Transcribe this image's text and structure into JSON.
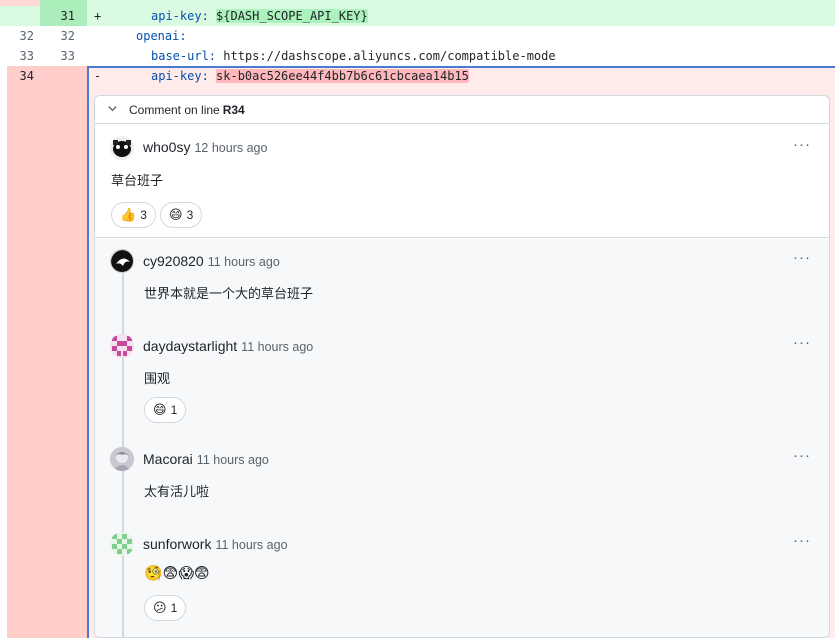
{
  "diff": {
    "added_row": {
      "old": "",
      "new": "31",
      "sign": "+",
      "key": "api-key:",
      "value": "${DASH_SCOPE_API_KEY}"
    },
    "ctx_row_1": {
      "old": "32",
      "new": "32",
      "text": "openai:"
    },
    "ctx_row_2": {
      "old": "33",
      "new": "33",
      "key": "base-url:",
      "value": "https://dashscope.aliyuncs.com/compatible-mode"
    },
    "deleted_row": {
      "old": "34",
      "sign": "-",
      "key": "api-key:",
      "value": "sk-b0ac526ee44f4bb7b6c61cbcaea14b15"
    }
  },
  "thread": {
    "header_prefix": "Comment on line",
    "header_line": "R34",
    "comments": [
      {
        "author": "who0sy",
        "time": "12 hours ago",
        "body": "草台班子",
        "reactions": [
          {
            "emoji": "👍",
            "count": "3"
          },
          {
            "emoji": "😄",
            "count": "3"
          }
        ]
      },
      {
        "author": "cy920820",
        "time": "11 hours ago",
        "body": "世界本就是一个大的草台班子",
        "reactions": []
      },
      {
        "author": "daydaystarlight",
        "time": "11 hours ago",
        "body": "围观",
        "reactions": [
          {
            "emoji": "😄",
            "count": "1"
          }
        ]
      },
      {
        "author": "Macorai",
        "time": "11 hours ago",
        "body": "太有活儿啦",
        "reactions": []
      },
      {
        "author": "sunforwork",
        "time": "11 hours ago",
        "body": "🧐😨😱😨",
        "reactions": [
          {
            "emoji": "😕",
            "count": "1"
          }
        ]
      }
    ],
    "more_label": "···"
  },
  "colors": {
    "added_bg": "#dafbe1",
    "deleted_bg": "#ffebe9",
    "accent": "#4a7bd0"
  }
}
